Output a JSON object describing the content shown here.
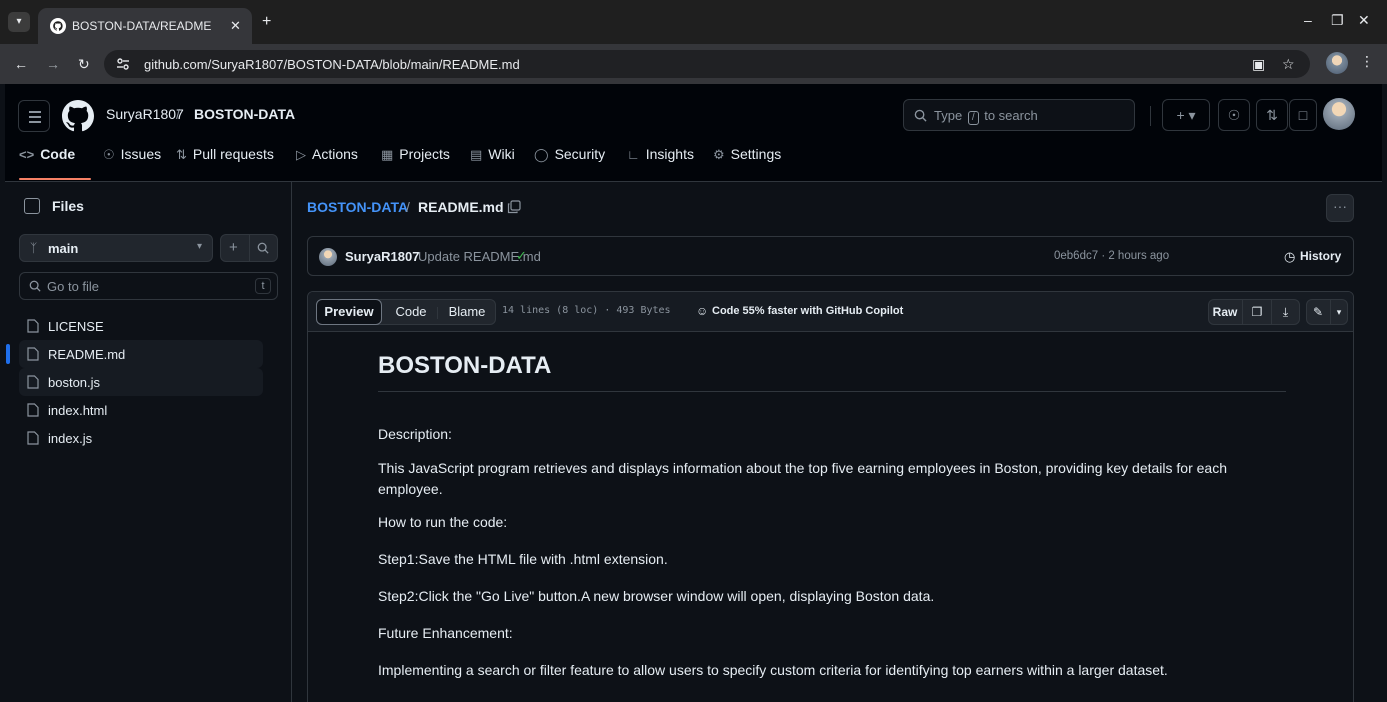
{
  "browser": {
    "tab_title": "BOSTON-DATA/README.md at",
    "url": "github.com/SuryaR1807/BOSTON-DATA/blob/main/README.md"
  },
  "header": {
    "owner": "SuryaR1807",
    "separator": "/",
    "repo": "BOSTON-DATA",
    "search_prefix": "Type",
    "search_key": "/",
    "search_suffix": "to search"
  },
  "nav": {
    "tabs": [
      {
        "label": "Code",
        "icon": "code-icon"
      },
      {
        "label": "Issues",
        "icon": "issue-icon"
      },
      {
        "label": "Pull requests",
        "icon": "pull-request-icon"
      },
      {
        "label": "Actions",
        "icon": "play-icon"
      },
      {
        "label": "Projects",
        "icon": "table-icon"
      },
      {
        "label": "Wiki",
        "icon": "book-icon"
      },
      {
        "label": "Security",
        "icon": "shield-icon"
      },
      {
        "label": "Insights",
        "icon": "graph-icon"
      },
      {
        "label": "Settings",
        "icon": "gear-icon"
      }
    ]
  },
  "sidebar": {
    "title": "Files",
    "branch": "main",
    "goto_placeholder": "Go to file",
    "goto_key": "t",
    "files": [
      "LICENSE",
      "README.md",
      "boston.js",
      "index.html",
      "index.js"
    ]
  },
  "breadcrumb": {
    "repo": "BOSTON-DATA",
    "sep": "/",
    "file": "README.md"
  },
  "commit": {
    "author": "SuryaR1807",
    "message": "Update README.md",
    "meta": "0eb6dc7 · 2 hours ago",
    "history": "History"
  },
  "file_toolbar": {
    "preview": "Preview",
    "code": "Code",
    "blame": "Blame",
    "stats": "14 lines (8 loc) · 493 Bytes",
    "copilot": "Code 55% faster with GitHub Copilot",
    "raw": "Raw"
  },
  "readme": {
    "title": "BOSTON-DATA",
    "paragraphs": [
      "Description:",
      "This JavaScript program retrieves and displays information about the top five earning employees in Boston, providing key details for each employee.",
      "How to run the code:",
      "Step1:Save the HTML file with .html extension.",
      "Step2:Click the \"Go Live\" button.A new browser window will open, displaying Boston data.",
      "Future Enhancement:",
      "Implementing a search or filter feature to allow users to specify custom criteria for identifying top earners within a larger dataset."
    ]
  },
  "colors": {
    "link": "#4493f8",
    "accent": "#f78166",
    "success": "#3fb950",
    "selection": "#1f6feb"
  }
}
